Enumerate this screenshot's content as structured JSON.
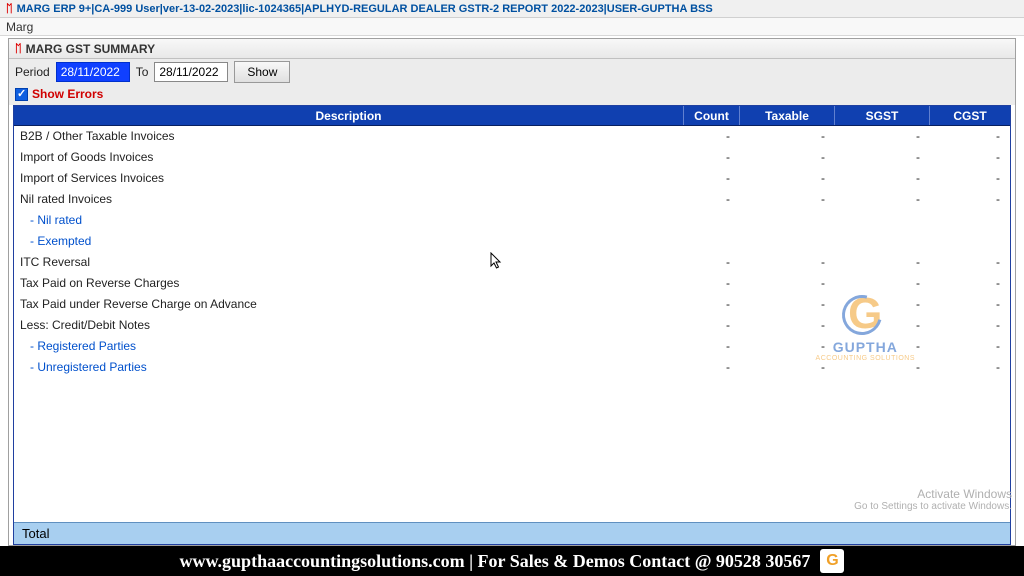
{
  "window": {
    "title": "MARG ERP 9+|CA-999 User|ver-13-02-2023|lic-1024365|APLHYD-REGULAR DEALER GSTR-2 REPORT 2022-2023|USER-GUPTHA BSS"
  },
  "menu": {
    "item1": "Marg"
  },
  "subwindow": {
    "title": "MARG GST SUMMARY"
  },
  "period": {
    "label": "Period",
    "from": "28/11/2022",
    "to_label": "To",
    "to": "28/11/2022",
    "show_btn": "Show"
  },
  "show_errors": {
    "label": "Show Errors"
  },
  "grid": {
    "headers": {
      "desc": "Description",
      "count": "Count",
      "taxable": "Taxable",
      "sgst": "SGST",
      "cgst": "CGST"
    },
    "rows": [
      {
        "desc": "B2B / Other Taxable Invoices",
        "link": false,
        "count": "-",
        "taxable": "-",
        "sgst": "-",
        "cgst": "-"
      },
      {
        "desc": "Import of Goods Invoices",
        "link": false,
        "count": "-",
        "taxable": "-",
        "sgst": "-",
        "cgst": "-"
      },
      {
        "desc": "Import of Services Invoices",
        "link": false,
        "count": "-",
        "taxable": "-",
        "sgst": "-",
        "cgst": "-"
      },
      {
        "desc": "Nil rated Invoices",
        "link": false,
        "count": "-",
        "taxable": "-",
        "sgst": "-",
        "cgst": "-"
      },
      {
        "desc": "- Nil rated",
        "link": true,
        "count": "",
        "taxable": "",
        "sgst": "",
        "cgst": ""
      },
      {
        "desc": "- Exempted",
        "link": true,
        "count": "",
        "taxable": "",
        "sgst": "",
        "cgst": ""
      },
      {
        "desc": "ITC Reversal",
        "link": false,
        "count": "-",
        "taxable": "-",
        "sgst": "-",
        "cgst": "-"
      },
      {
        "desc": "Tax Paid on Reverse Charges",
        "link": false,
        "count": "-",
        "taxable": "-",
        "sgst": "-",
        "cgst": "-"
      },
      {
        "desc": "Tax Paid under Reverse Charge on Advance",
        "link": false,
        "count": "-",
        "taxable": "-",
        "sgst": "-",
        "cgst": "-"
      },
      {
        "desc": "Less: Credit/Debit Notes",
        "link": false,
        "count": "-",
        "taxable": "-",
        "sgst": "-",
        "cgst": "-"
      },
      {
        "desc": "- Registered Parties",
        "link": true,
        "count": "-",
        "taxable": "-",
        "sgst": "-",
        "cgst": "-"
      },
      {
        "desc": "- Unregistered Parties",
        "link": true,
        "count": "-",
        "taxable": "-",
        "sgst": "-",
        "cgst": "-"
      }
    ],
    "total_label": "Total"
  },
  "watermark": {
    "brand": "GUPTHA",
    "sub": "ACCOUNTING SOLUTIONS"
  },
  "activate": {
    "line1": "Activate Windows",
    "line2": "Go to Settings to activate Windows."
  },
  "footer": {
    "text": "www.gupthaaccountingsolutions.com | For Sales & Demos Contact @ 90528 30567"
  }
}
